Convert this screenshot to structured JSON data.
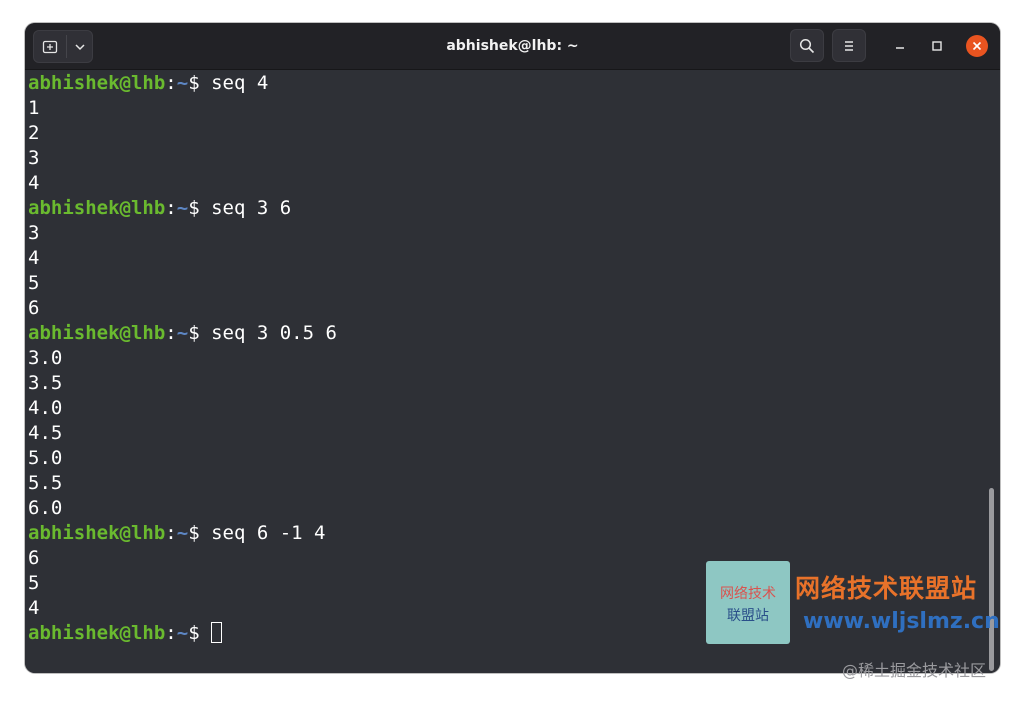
{
  "window": {
    "title": "abhishek@lhb: ~"
  },
  "titlebar": {
    "icons": {
      "new_tab": "new-tab-icon",
      "tab_menu": "chevron-down-icon",
      "search": "search-icon",
      "menu": "hamburger-menu-icon",
      "minimize": "minimize-icon",
      "maximize": "maximize-icon",
      "close": "close-icon"
    }
  },
  "prompt": {
    "user_host": "abhishek@lhb",
    "colon": ":",
    "path": "~",
    "symbol": "$"
  },
  "terminal": {
    "lines": [
      {
        "type": "prompt",
        "command": "seq 4"
      },
      {
        "type": "output",
        "text": "1"
      },
      {
        "type": "output",
        "text": "2"
      },
      {
        "type": "output",
        "text": "3"
      },
      {
        "type": "output",
        "text": "4"
      },
      {
        "type": "prompt",
        "command": "seq 3 6"
      },
      {
        "type": "output",
        "text": "3"
      },
      {
        "type": "output",
        "text": "4"
      },
      {
        "type": "output",
        "text": "5"
      },
      {
        "type": "output",
        "text": "6"
      },
      {
        "type": "prompt",
        "command": "seq 3 0.5 6"
      },
      {
        "type": "output",
        "text": "3.0"
      },
      {
        "type": "output",
        "text": "3.5"
      },
      {
        "type": "output",
        "text": "4.0"
      },
      {
        "type": "output",
        "text": "4.5"
      },
      {
        "type": "output",
        "text": "5.0"
      },
      {
        "type": "output",
        "text": "5.5"
      },
      {
        "type": "output",
        "text": "6.0"
      },
      {
        "type": "prompt",
        "command": "seq 6 -1 4"
      },
      {
        "type": "output",
        "text": "6"
      },
      {
        "type": "output",
        "text": "5"
      },
      {
        "type": "output",
        "text": "4"
      },
      {
        "type": "prompt",
        "command": "",
        "cursor": true
      }
    ]
  },
  "watermark": {
    "logo_line1": "网络技术",
    "logo_line2": "联盟站",
    "site_name": "网络技术联盟站",
    "site_url": "www.wljslmz.cn",
    "juejin": "@稀土掘金技术社区"
  },
  "colors": {
    "terminal_bg": "#2e3036",
    "titlebar_bg": "#222226",
    "prompt_user": "#6aba2f",
    "prompt_path": "#5d86c4",
    "close_button": "#e95420",
    "watermark_orange": "#e8722a",
    "watermark_blue": "#2f6fc0"
  }
}
